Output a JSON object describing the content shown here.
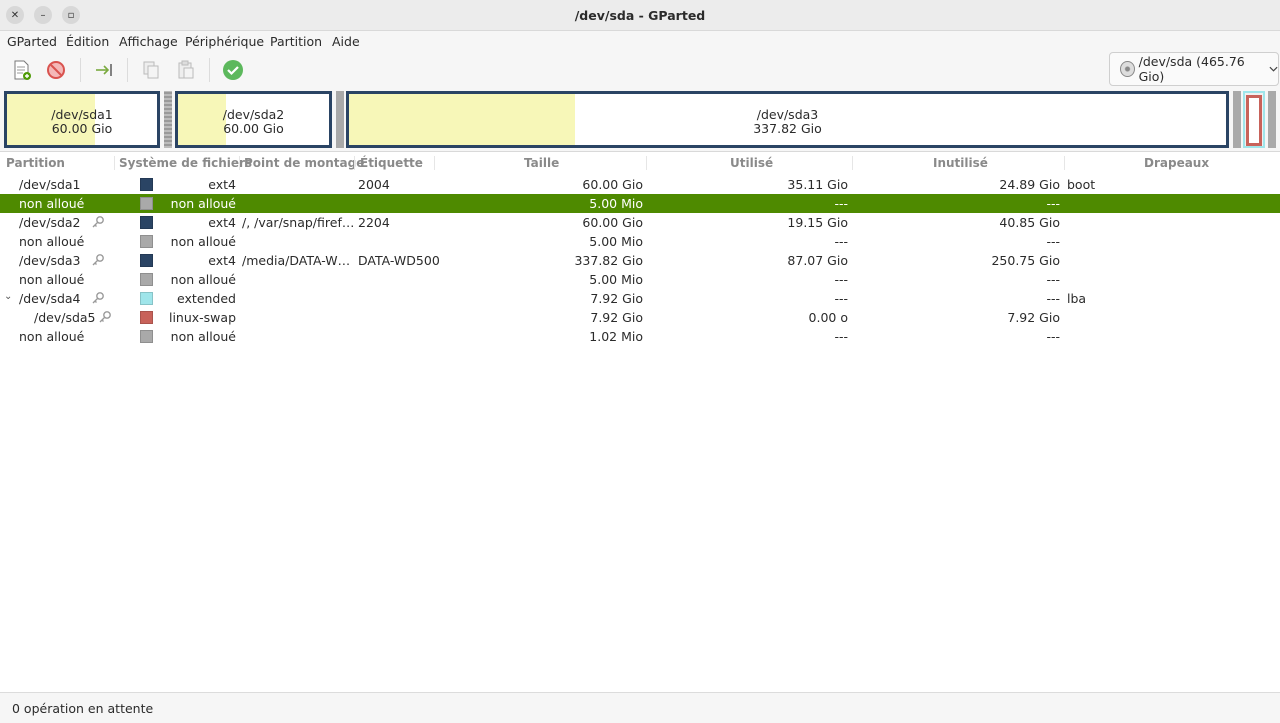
{
  "window": {
    "title": "/dev/sda - GParted",
    "close_glyph": "✕",
    "minimize_glyph": "–",
    "maximize_glyph": "▫"
  },
  "menu": [
    "GParted",
    "Édition",
    "Affichage",
    "Périphérique",
    "Partition",
    "Aide"
  ],
  "toolbar": {
    "icons": [
      "new-partition-icon",
      "delete-icon",
      "resize-move-icon",
      "copy-icon",
      "paste-icon",
      "apply-icon"
    ],
    "device_selector": "/dev/sda (465.76 Gio)"
  },
  "colors": {
    "selection": "#4e8a00",
    "partition_border": "#2a4464",
    "used_space": "#f7f7b8",
    "unallocated": "#a9a9a9",
    "extended": "#9fe5ea",
    "swap": "#c8625a",
    "ext4": "#2a4464"
  },
  "partition_map": {
    "sda1": {
      "name": "/dev/sda1",
      "size": "60.00 Gio",
      "used_fraction": 0.585
    },
    "sda2": {
      "name": "/dev/sda2",
      "size": "60.00 Gio",
      "used_fraction": 0.319
    },
    "sda3": {
      "name": "/dev/sda3",
      "size": "337.82 Gio",
      "used_fraction": 0.258
    }
  },
  "table": {
    "columns": [
      "Partition",
      "Système de fichiers",
      "Point de montage",
      "Étiquette",
      "Taille",
      "Utilisé",
      "Inutilisé",
      "Drapeaux"
    ],
    "rows": [
      {
        "partition": "/dev/sda1",
        "fs": "ext4",
        "fs_color": "#2a4464",
        "mount": "",
        "label": "2004",
        "size": "60.00 Gio",
        "used": "35.11 Gio",
        "unused": "24.89 Gio",
        "flags": "boot",
        "key": false
      },
      {
        "partition": "non alloué",
        "fs": "non alloué",
        "fs_color": "#a9a9a9",
        "mount": "",
        "label": "",
        "size": "5.00 Mio",
        "used": "---",
        "unused": "---",
        "flags": "",
        "key": false
      },
      {
        "partition": "/dev/sda2",
        "fs": "ext4",
        "fs_color": "#2a4464",
        "mount": "/, /var/snap/firef…",
        "label": "2204",
        "size": "60.00 Gio",
        "used": "19.15 Gio",
        "unused": "40.85 Gio",
        "flags": "",
        "key": true
      },
      {
        "partition": "non alloué",
        "fs": "non alloué",
        "fs_color": "#a9a9a9",
        "mount": "",
        "label": "",
        "size": "5.00 Mio",
        "used": "---",
        "unused": "---",
        "flags": "",
        "key": false
      },
      {
        "partition": "/dev/sda3",
        "fs": "ext4",
        "fs_color": "#2a4464",
        "mount": "/media/DATA-W…",
        "label": "DATA-WD500",
        "size": "337.82 Gio",
        "used": "87.07 Gio",
        "unused": "250.75 Gio",
        "flags": "",
        "key": true
      },
      {
        "partition": "non alloué",
        "fs": "non alloué",
        "fs_color": "#a9a9a9",
        "mount": "",
        "label": "",
        "size": "5.00 Mio",
        "used": "---",
        "unused": "---",
        "flags": "",
        "key": false
      },
      {
        "partition": "/dev/sda4",
        "fs": "extended",
        "fs_color": "#9fe5ea",
        "mount": "",
        "label": "",
        "size": "7.92 Gio",
        "used": "---",
        "unused": "---",
        "flags": "lba",
        "key": true,
        "expander": "⌄"
      },
      {
        "partition": "/dev/sda5",
        "fs": "linux-swap",
        "fs_color": "#c8625a",
        "mount": "",
        "label": "",
        "size": "7.92 Gio",
        "used": "0.00 o",
        "unused": "7.92 Gio",
        "flags": "",
        "key": true
      },
      {
        "partition": "non alloué",
        "fs": "non alloué",
        "fs_color": "#a9a9a9",
        "mount": "",
        "label": "",
        "size": "1.02 Mio",
        "used": "---",
        "unused": "---",
        "flags": "",
        "key": false
      }
    ]
  },
  "status": "0 opération en attente"
}
